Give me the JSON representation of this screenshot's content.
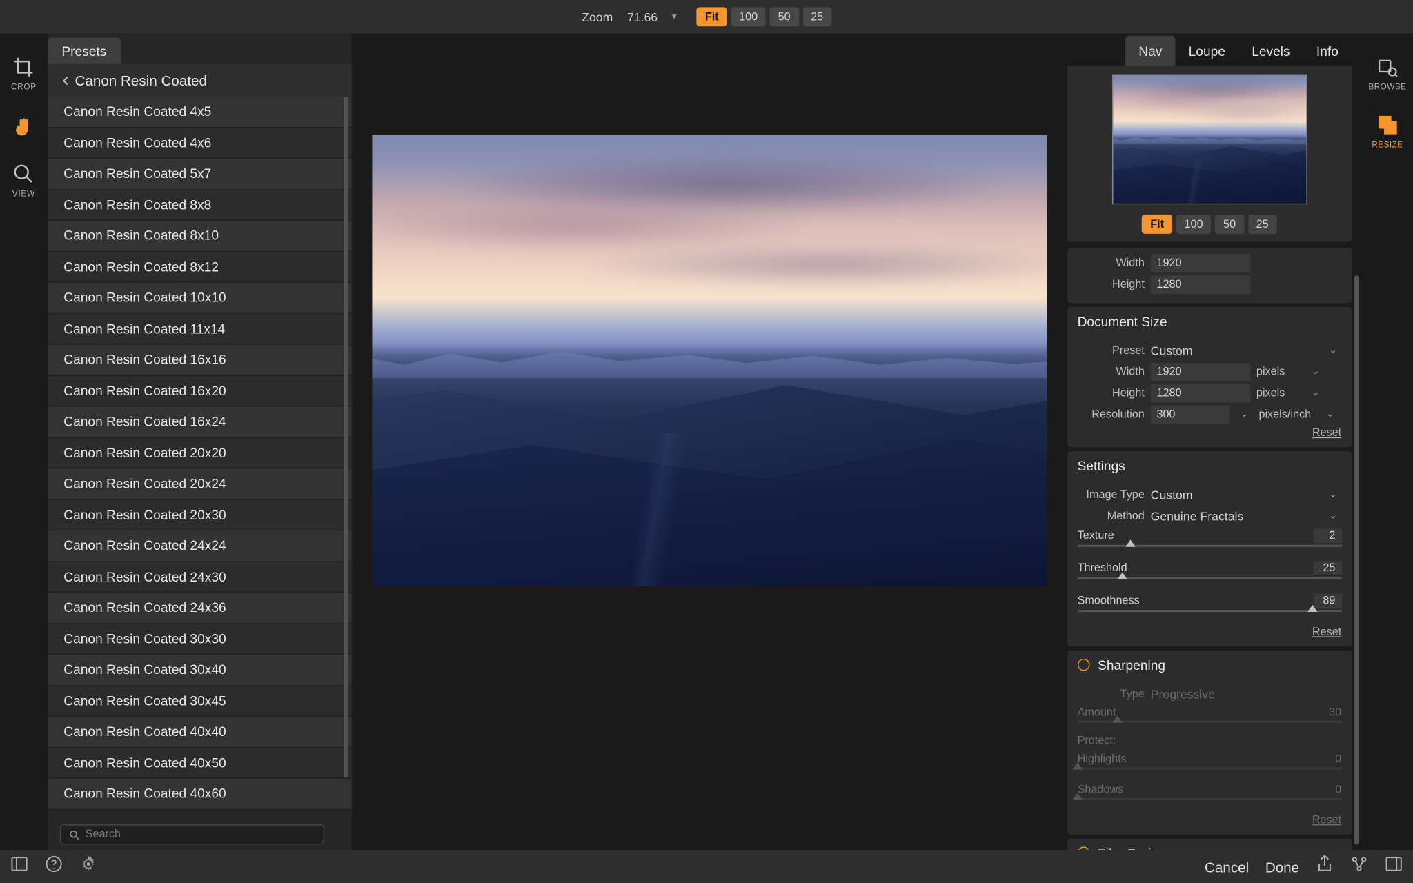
{
  "topbar": {
    "zoom_label": "Zoom",
    "zoom_value": "71.66",
    "buttons": [
      "Fit",
      "100",
      "50",
      "25"
    ],
    "active": 0
  },
  "left_rail": {
    "crop": "CROP",
    "view": "VIEW"
  },
  "presets": {
    "tab": "Presets",
    "breadcrumb": "Canon Resin Coated",
    "items": [
      "Canon Resin Coated 4x5",
      "Canon Resin Coated 4x6",
      "Canon Resin Coated 5x7",
      "Canon Resin Coated 8x8",
      "Canon Resin Coated 8x10",
      "Canon Resin Coated 8x12",
      "Canon Resin Coated 10x10",
      "Canon Resin Coated 11x14",
      "Canon Resin Coated 16x16",
      "Canon Resin Coated 16x20",
      "Canon Resin Coated 16x24",
      "Canon Resin Coated 20x20",
      "Canon Resin Coated 20x24",
      "Canon Resin Coated 20x30",
      "Canon Resin Coated 24x24",
      "Canon Resin Coated 24x30",
      "Canon Resin Coated 24x36",
      "Canon Resin Coated 30x30",
      "Canon Resin Coated 30x40",
      "Canon Resin Coated 30x45",
      "Canon Resin Coated 40x40",
      "Canon Resin Coated 40x50",
      "Canon Resin Coated 40x60"
    ],
    "search_placeholder": "Search"
  },
  "right_tabs": {
    "items": [
      "Nav",
      "Loupe",
      "Levels",
      "Info"
    ],
    "active": 0
  },
  "nav": {
    "buttons": [
      "Fit",
      "100",
      "50",
      "25"
    ],
    "active": 0
  },
  "pixel_dims": {
    "width_label": "Width",
    "width": "1920",
    "height_label": "Height",
    "height": "1280"
  },
  "document_size": {
    "title": "Document Size",
    "preset_label": "Preset",
    "preset": "Custom",
    "width_label": "Width",
    "width": "1920",
    "width_unit": "pixels",
    "height_label": "Height",
    "height": "1280",
    "height_unit": "pixels",
    "resolution_label": "Resolution",
    "resolution": "300",
    "resolution_unit": "pixels/inch",
    "reset": "Reset"
  },
  "settings": {
    "title": "Settings",
    "image_type_label": "Image Type",
    "image_type": "Custom",
    "method_label": "Method",
    "method": "Genuine Fractals",
    "texture_label": "Texture",
    "texture": "2",
    "threshold_label": "Threshold",
    "threshold": "25",
    "smoothness_label": "Smoothness",
    "smoothness": "89",
    "reset": "Reset"
  },
  "sharpening": {
    "title": "Sharpening",
    "type_label": "Type",
    "type": "Progressive",
    "amount_label": "Amount",
    "amount": "30",
    "protect_label": "Protect:",
    "highlights_label": "Highlights",
    "highlights": "0",
    "shadows_label": "Shadows",
    "shadows": "0",
    "reset": "Reset"
  },
  "film_grain": {
    "title": "Film Grain"
  },
  "right_rail": {
    "browse": "BROWSE",
    "resize": "RESIZE"
  },
  "bottom": {
    "cancel": "Cancel",
    "done": "Done"
  }
}
